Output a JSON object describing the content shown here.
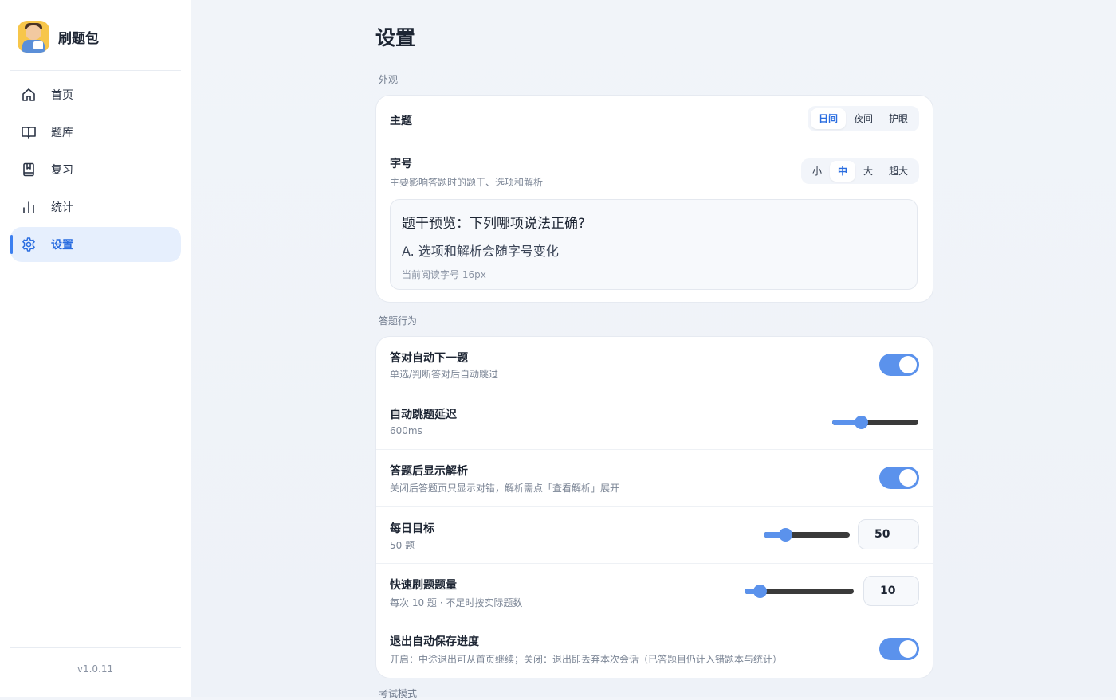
{
  "app": {
    "name": "刷题包",
    "version": "v1.0.11"
  },
  "nav": [
    {
      "label": "首页",
      "icon": "home-icon"
    },
    {
      "label": "题库",
      "icon": "book-open-icon"
    },
    {
      "label": "复习",
      "icon": "bookmark-book-icon"
    },
    {
      "label": "统计",
      "icon": "bar-chart-icon"
    },
    {
      "label": "设置",
      "icon": "gear-icon",
      "active": true
    }
  ],
  "page": {
    "title": "设置"
  },
  "appearance": {
    "section_label": "外观",
    "theme": {
      "title": "主题",
      "options": [
        "日间",
        "夜间",
        "护眼"
      ],
      "selected": "日间"
    },
    "font_size": {
      "title": "字号",
      "subtitle": "主要影响答题时的题干、选项和解析",
      "options": [
        "小",
        "中",
        "大",
        "超大"
      ],
      "selected": "中",
      "preview": {
        "question": "题干预览：下列哪项说法正确?",
        "option": "A. 选项和解析会随字号变化",
        "note": "当前阅读字号 16px"
      }
    }
  },
  "behavior": {
    "section_label": "答题行为",
    "auto_next": {
      "title": "答对自动下一题",
      "subtitle": "单选/判断答对后自动跳过",
      "enabled": true
    },
    "auto_delay": {
      "title": "自动跳题延迟",
      "value_label": "600ms",
      "fraction": 0.33
    },
    "show_explanation": {
      "title": "答题后显示解析",
      "subtitle": "关闭后答题页只显示对错，解析需点「查看解析」展开",
      "enabled": true
    },
    "daily_goal": {
      "title": "每日目标",
      "subtitle": "50 题",
      "value": "50",
      "fraction": 0.25
    },
    "quick_count": {
      "title": "快速刷题题量",
      "subtitle": "每次 10 题 · 不足时按实际题数",
      "value": "10",
      "fraction": 0.14
    },
    "autosave": {
      "title": "退出自动保存进度",
      "subtitle": "开启：中途退出可从首页继续；关闭：退出即丢弃本次会话（已答题目仍计入错题本与统计）",
      "enabled": true
    }
  },
  "next_section_label": "考试模式",
  "colors": {
    "accent": "#3b7ff0",
    "toggle_on": "#5b92ec",
    "active_nav_bg": "#e6effd"
  }
}
